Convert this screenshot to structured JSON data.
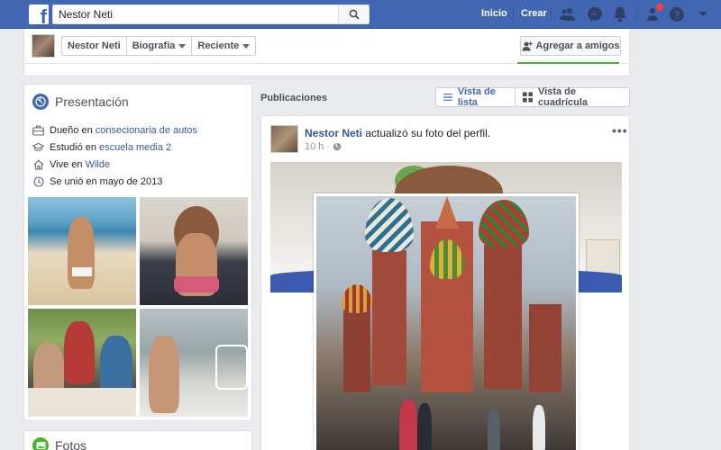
{
  "topbar": {
    "search_value": "Nestor Neti",
    "nav": [
      "Inicio",
      "Crear"
    ]
  },
  "profile_bar": {
    "tabs": [
      {
        "label": "Nestor Neti",
        "caret": false
      },
      {
        "label": "Biografía",
        "caret": true
      },
      {
        "label": "Reciente",
        "caret": true
      }
    ],
    "add_friend_label": "Agregar a amigos"
  },
  "intro": {
    "title": "Presentación",
    "items": [
      {
        "icon": "briefcase-icon",
        "text": "Dueño en ",
        "link": "consecionaria de autos"
      },
      {
        "icon": "graduation-cap-icon",
        "text": "Estudió en ",
        "link": "escuela media 2"
      },
      {
        "icon": "home-icon",
        "text": "Vive en ",
        "link": "Wilde"
      },
      {
        "icon": "clock-icon",
        "text": "Se unió en mayo de 2013",
        "link": ""
      }
    ]
  },
  "fotos": {
    "title": "Fotos"
  },
  "publications": {
    "label": "Publicaciones",
    "list_view_label": "Vista de lista",
    "grid_view_label": "Vista de cuadrícula"
  },
  "post": {
    "author": "Nestor Neti",
    "action": " actualizó su foto del perfil.",
    "time": "10 h",
    "more": "•••"
  },
  "colors": {
    "brand": "#4267b2",
    "link": "#365899",
    "notification": "#fa3e3e",
    "accent_green": "#42b72a"
  }
}
